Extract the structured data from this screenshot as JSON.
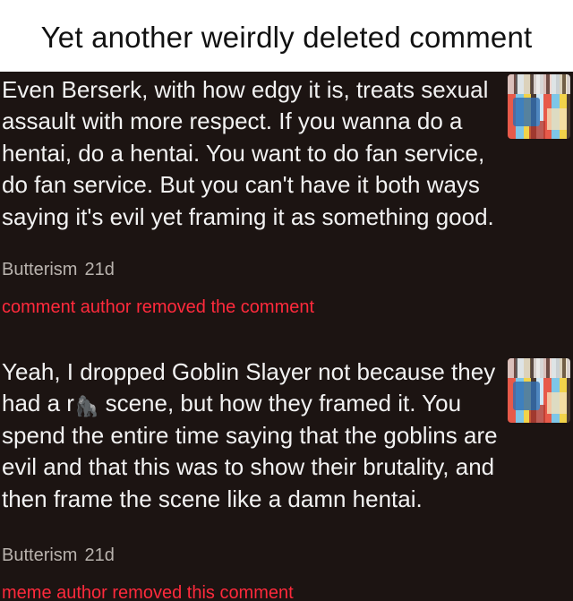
{
  "header": {
    "title": "Yet another weirdly deleted comment"
  },
  "comments": [
    {
      "text": "Even Berserk, with how edgy it is, treats sexual assault with more respect. If you wanna do a hentai, do a hentai. You want to do fan service, do fan service. But you can't have it both ways saying it's evil yet framing it as something good.",
      "author": "Butterism",
      "age": "21d",
      "removed_text": "comment author removed the comment"
    },
    {
      "text_before_emoji": "Yeah, I dropped Goblin Slayer not because they had a r",
      "emoji": "🦍",
      "text_after_emoji": " scene, but how they framed it. You spend the entire time saying that the goblins are evil and that this was to show their brutality, and then frame the scene like a damn hentai.",
      "author": "Butterism",
      "age": "21d",
      "removed_text": "meme author removed this comment"
    }
  ],
  "icons": {
    "thumbnail": "meme-thumbnail-icon"
  },
  "colors": {
    "background": "#1c1412",
    "text": "#f2f2f2",
    "meta": "#b9b3ae",
    "removed": "#ff2a3c"
  }
}
